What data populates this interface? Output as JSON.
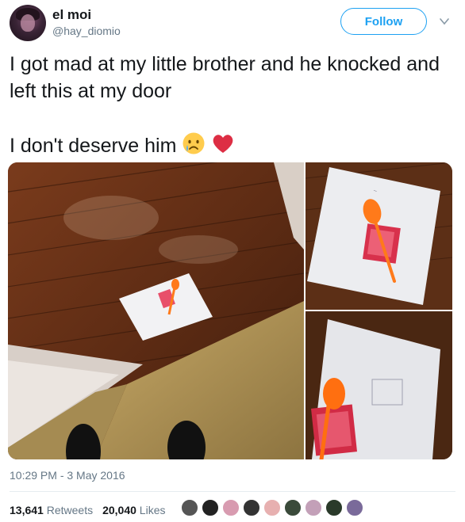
{
  "author": {
    "name": "el moi",
    "handle": "@hay_diomio"
  },
  "follow_label": "Follow",
  "tweet": {
    "line1": "I got mad at my little brother and he knocked and left this at my door",
    "line2": "I don't deserve him"
  },
  "timestamp": "10:29 PM - 3 May 2016",
  "stats": {
    "retweets_count": "13,641",
    "retweets_label": "Retweets",
    "likes_count": "20,040",
    "likes_label": "Likes"
  },
  "icons": {
    "menu": "chevron-down-icon",
    "emoji1": "crying-face-icon",
    "emoji2": "red-heart-icon"
  },
  "colors": {
    "accent": "#1da1f2",
    "text": "#14171a",
    "muted": "#657786"
  }
}
